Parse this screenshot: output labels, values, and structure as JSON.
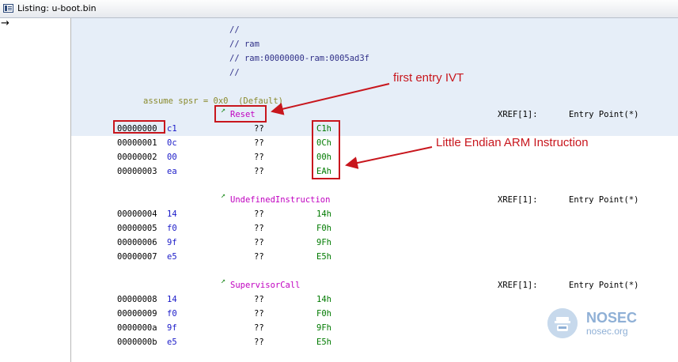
{
  "window": {
    "title": "Listing: u-boot.bin"
  },
  "gutter": {
    "cursor_glyph": "→"
  },
  "header_comments": [
    "//",
    "// ram",
    "// ram:00000000-ram:0005ad3f",
    "//"
  ],
  "assume_line": "assume spsr = 0x0  (Default)",
  "sections": [
    {
      "label": "Reset",
      "xref": "XREF[1]:",
      "xref_target": "Entry Point(*)",
      "rows": [
        {
          "address": "00000000",
          "byte": "c1",
          "mnemonic": "??",
          "value": "C1h"
        },
        {
          "address": "00000001",
          "byte": "0c",
          "mnemonic": "??",
          "value": "0Ch"
        },
        {
          "address": "00000002",
          "byte": "00",
          "mnemonic": "??",
          "value": "00h"
        },
        {
          "address": "00000003",
          "byte": "ea",
          "mnemonic": "??",
          "value": "EAh"
        }
      ]
    },
    {
      "label": "UndefinedInstruction",
      "xref": "XREF[1]:",
      "xref_target": "Entry Point(*)",
      "rows": [
        {
          "address": "00000004",
          "byte": "14",
          "mnemonic": "??",
          "value": "14h"
        },
        {
          "address": "00000005",
          "byte": "f0",
          "mnemonic": "??",
          "value": "F0h"
        },
        {
          "address": "00000006",
          "byte": "9f",
          "mnemonic": "??",
          "value": "9Fh"
        },
        {
          "address": "00000007",
          "byte": "e5",
          "mnemonic": "??",
          "value": "E5h"
        }
      ]
    },
    {
      "label": "SupervisorCall",
      "xref": "XREF[1]:",
      "xref_target": "Entry Point(*)",
      "rows": [
        {
          "address": "00000008",
          "byte": "14",
          "mnemonic": "??",
          "value": "14h"
        },
        {
          "address": "00000009",
          "byte": "f0",
          "mnemonic": "??",
          "value": "F0h"
        },
        {
          "address": "0000000a",
          "byte": "9f",
          "mnemonic": "??",
          "value": "9Fh"
        },
        {
          "address": "0000000b",
          "byte": "e5",
          "mnemonic": "??",
          "value": "E5h"
        }
      ]
    }
  ],
  "annotations": {
    "first_entry": "first entry IVT",
    "little_endian": "Little Endian ARM Instruction"
  },
  "watermark": {
    "name": "NOSEC",
    "url": "nosec.org"
  },
  "colors": {
    "annotation": "#c8161d",
    "label": "#c000c0",
    "value": "#007a00",
    "byte": "#1a1ac8",
    "selection": "#e6eef8"
  }
}
